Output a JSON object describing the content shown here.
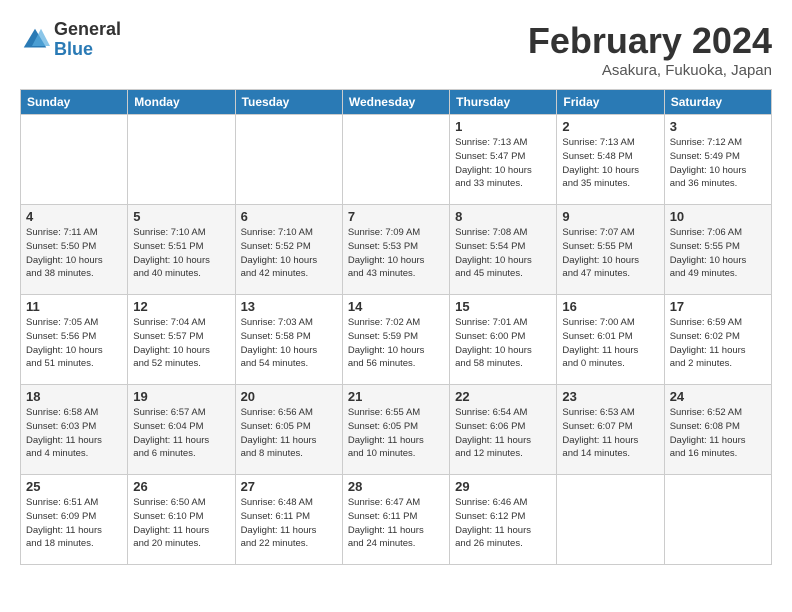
{
  "logo": {
    "general": "General",
    "blue": "Blue"
  },
  "title": "February 2024",
  "subtitle": "Asakura, Fukuoka, Japan",
  "weekdays": [
    "Sunday",
    "Monday",
    "Tuesday",
    "Wednesday",
    "Thursday",
    "Friday",
    "Saturday"
  ],
  "weeks": [
    [
      {
        "day": "",
        "info": ""
      },
      {
        "day": "",
        "info": ""
      },
      {
        "day": "",
        "info": ""
      },
      {
        "day": "",
        "info": ""
      },
      {
        "day": "1",
        "info": "Sunrise: 7:13 AM\nSunset: 5:47 PM\nDaylight: 10 hours\nand 33 minutes."
      },
      {
        "day": "2",
        "info": "Sunrise: 7:13 AM\nSunset: 5:48 PM\nDaylight: 10 hours\nand 35 minutes."
      },
      {
        "day": "3",
        "info": "Sunrise: 7:12 AM\nSunset: 5:49 PM\nDaylight: 10 hours\nand 36 minutes."
      }
    ],
    [
      {
        "day": "4",
        "info": "Sunrise: 7:11 AM\nSunset: 5:50 PM\nDaylight: 10 hours\nand 38 minutes."
      },
      {
        "day": "5",
        "info": "Sunrise: 7:10 AM\nSunset: 5:51 PM\nDaylight: 10 hours\nand 40 minutes."
      },
      {
        "day": "6",
        "info": "Sunrise: 7:10 AM\nSunset: 5:52 PM\nDaylight: 10 hours\nand 42 minutes."
      },
      {
        "day": "7",
        "info": "Sunrise: 7:09 AM\nSunset: 5:53 PM\nDaylight: 10 hours\nand 43 minutes."
      },
      {
        "day": "8",
        "info": "Sunrise: 7:08 AM\nSunset: 5:54 PM\nDaylight: 10 hours\nand 45 minutes."
      },
      {
        "day": "9",
        "info": "Sunrise: 7:07 AM\nSunset: 5:55 PM\nDaylight: 10 hours\nand 47 minutes."
      },
      {
        "day": "10",
        "info": "Sunrise: 7:06 AM\nSunset: 5:55 PM\nDaylight: 10 hours\nand 49 minutes."
      }
    ],
    [
      {
        "day": "11",
        "info": "Sunrise: 7:05 AM\nSunset: 5:56 PM\nDaylight: 10 hours\nand 51 minutes."
      },
      {
        "day": "12",
        "info": "Sunrise: 7:04 AM\nSunset: 5:57 PM\nDaylight: 10 hours\nand 52 minutes."
      },
      {
        "day": "13",
        "info": "Sunrise: 7:03 AM\nSunset: 5:58 PM\nDaylight: 10 hours\nand 54 minutes."
      },
      {
        "day": "14",
        "info": "Sunrise: 7:02 AM\nSunset: 5:59 PM\nDaylight: 10 hours\nand 56 minutes."
      },
      {
        "day": "15",
        "info": "Sunrise: 7:01 AM\nSunset: 6:00 PM\nDaylight: 10 hours\nand 58 minutes."
      },
      {
        "day": "16",
        "info": "Sunrise: 7:00 AM\nSunset: 6:01 PM\nDaylight: 11 hours\nand 0 minutes."
      },
      {
        "day": "17",
        "info": "Sunrise: 6:59 AM\nSunset: 6:02 PM\nDaylight: 11 hours\nand 2 minutes."
      }
    ],
    [
      {
        "day": "18",
        "info": "Sunrise: 6:58 AM\nSunset: 6:03 PM\nDaylight: 11 hours\nand 4 minutes."
      },
      {
        "day": "19",
        "info": "Sunrise: 6:57 AM\nSunset: 6:04 PM\nDaylight: 11 hours\nand 6 minutes."
      },
      {
        "day": "20",
        "info": "Sunrise: 6:56 AM\nSunset: 6:05 PM\nDaylight: 11 hours\nand 8 minutes."
      },
      {
        "day": "21",
        "info": "Sunrise: 6:55 AM\nSunset: 6:05 PM\nDaylight: 11 hours\nand 10 minutes."
      },
      {
        "day": "22",
        "info": "Sunrise: 6:54 AM\nSunset: 6:06 PM\nDaylight: 11 hours\nand 12 minutes."
      },
      {
        "day": "23",
        "info": "Sunrise: 6:53 AM\nSunset: 6:07 PM\nDaylight: 11 hours\nand 14 minutes."
      },
      {
        "day": "24",
        "info": "Sunrise: 6:52 AM\nSunset: 6:08 PM\nDaylight: 11 hours\nand 16 minutes."
      }
    ],
    [
      {
        "day": "25",
        "info": "Sunrise: 6:51 AM\nSunset: 6:09 PM\nDaylight: 11 hours\nand 18 minutes."
      },
      {
        "day": "26",
        "info": "Sunrise: 6:50 AM\nSunset: 6:10 PM\nDaylight: 11 hours\nand 20 minutes."
      },
      {
        "day": "27",
        "info": "Sunrise: 6:48 AM\nSunset: 6:11 PM\nDaylight: 11 hours\nand 22 minutes."
      },
      {
        "day": "28",
        "info": "Sunrise: 6:47 AM\nSunset: 6:11 PM\nDaylight: 11 hours\nand 24 minutes."
      },
      {
        "day": "29",
        "info": "Sunrise: 6:46 AM\nSunset: 6:12 PM\nDaylight: 11 hours\nand 26 minutes."
      },
      {
        "day": "",
        "info": ""
      },
      {
        "day": "",
        "info": ""
      }
    ]
  ]
}
